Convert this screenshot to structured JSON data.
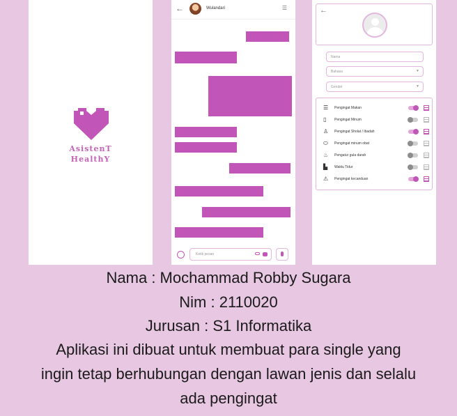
{
  "splash": {
    "brand_line1": "AsistenT",
    "brand_line2": "HealthY",
    "brand_color": "#c563b8"
  },
  "chat": {
    "contact_name": "Wulandari",
    "back_icon": "arrow-left-icon",
    "menu_icon": "menu-icon",
    "input_placeholder": "Ketik pesan",
    "bubble_color": "#c156b8"
  },
  "profile": {
    "fields": {
      "name": "Nama",
      "language": "Bahasa",
      "gender": "Gender"
    },
    "reminders": [
      {
        "label": "Pengingat Makan",
        "icon": "food-icon",
        "enabled": true
      },
      {
        "label": "Pengingat Minum",
        "icon": "glass-icon",
        "enabled": false
      },
      {
        "label": "Pengingat Sholat / Ibadah",
        "icon": "prayer-icon",
        "enabled": true
      },
      {
        "label": "Pengingat minum obat",
        "icon": "pill-icon",
        "enabled": false
      },
      {
        "label": "Pengatur gula darah",
        "icon": "blood-sugar-icon",
        "enabled": false
      },
      {
        "label": "Waktu Tidur",
        "icon": "bed-icon",
        "enabled": false
      },
      {
        "label": "Pengingat kecanduan",
        "icon": "addiction-icon",
        "enabled": true
      }
    ],
    "accent_color": "#c156b8"
  },
  "caption": {
    "line1": "Nama : Mochammad Robby Sugara",
    "line2": "Nim : 2110020",
    "line3": "Jurusan : S1 Informatika",
    "line4": "Aplikasi ini dibuat untuk membuat para single yang",
    "line5": "ingin tetap berhubungan dengan lawan jenis dan selalu",
    "line6": "ada pengingat"
  }
}
